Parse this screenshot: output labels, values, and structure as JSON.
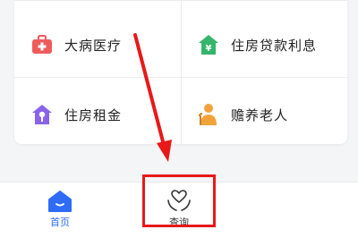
{
  "grid": {
    "items": [
      {
        "label": "大病医疗",
        "icon": "medical-kit-icon",
        "color": "#ef5b5b"
      },
      {
        "label": "住房贷款利息",
        "icon": "house-yen-icon",
        "color": "#35b56b"
      },
      {
        "label": "住房租金",
        "icon": "house-key-icon",
        "color": "#8a63e8"
      },
      {
        "label": "赡养老人",
        "icon": "elderly-person-icon",
        "color": "#f2a23a"
      }
    ]
  },
  "tabbar": {
    "tabs": [
      {
        "label": "首页",
        "icon": "home-icon",
        "color": "#2f6cf6"
      },
      {
        "label": "查询",
        "icon": "heart-hands-icon",
        "color": "#333333"
      }
    ]
  },
  "annotation": {
    "arrow_color": "#e81818",
    "box_color": "#e81818"
  }
}
